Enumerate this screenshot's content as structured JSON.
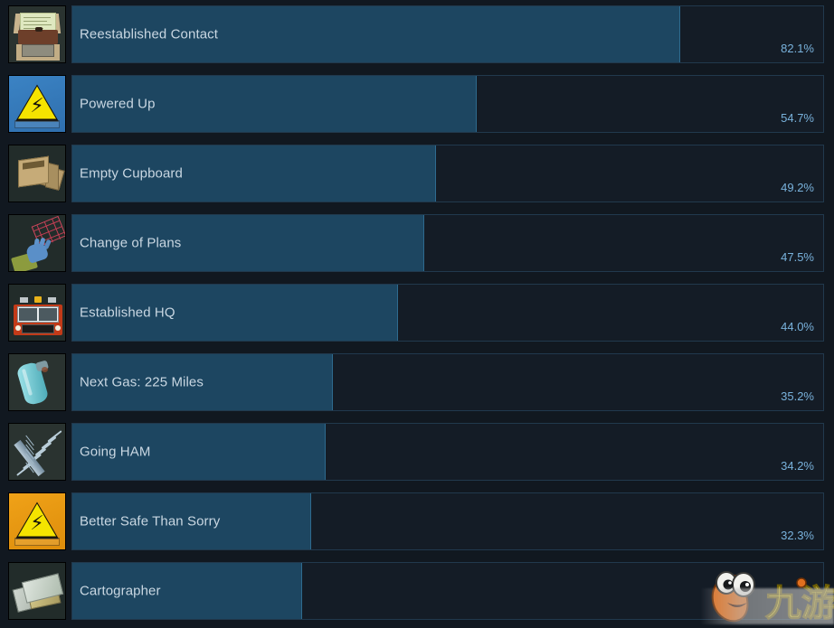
{
  "page": {
    "kind": "steam-global-achievement-percentages",
    "colors": {
      "page_background": "#111820",
      "bar_track": "#141c26",
      "bar_fill": "#1d4661",
      "bar_border": "#21394d",
      "title_text": "#c9d7e2",
      "percent_text": "#79b2dc"
    }
  },
  "watermark": {
    "text": "九游",
    "mascot": "orange-mascot-icon"
  },
  "achievements": [
    {
      "icon": "typewriter-radio-icon",
      "name": "Reestablished Contact",
      "percent": "82.1%",
      "value": 82.1
    },
    {
      "icon": "blue-electrical-hazard-icon",
      "name": "Powered Up",
      "percent": "54.7%",
      "value": 54.7
    },
    {
      "icon": "open-wooden-crate-icon",
      "name": "Empty Cupboard",
      "percent": "49.2%",
      "value": 49.2
    },
    {
      "icon": "gloved-hand-blueprint-icon",
      "name": "Change of Plans",
      "percent": "47.5%",
      "value": 47.5
    },
    {
      "icon": "red-fire-truck-icon",
      "name": "Established HQ",
      "percent": "44.0%",
      "value": 44.0
    },
    {
      "icon": "gas-canister-icon",
      "name": "Next Gas: 225 Miles",
      "percent": "35.2%",
      "value": 35.2
    },
    {
      "icon": "radio-antenna-icon",
      "name": "Going HAM",
      "percent": "34.2%",
      "value": 34.2
    },
    {
      "icon": "orange-electrical-hazard-icon",
      "name": "Better Safe Than Sorry",
      "percent": "32.3%",
      "value": 32.3
    },
    {
      "icon": "folded-maps-icon",
      "name": "Cartographer",
      "percent": "",
      "value": 31.0
    }
  ]
}
